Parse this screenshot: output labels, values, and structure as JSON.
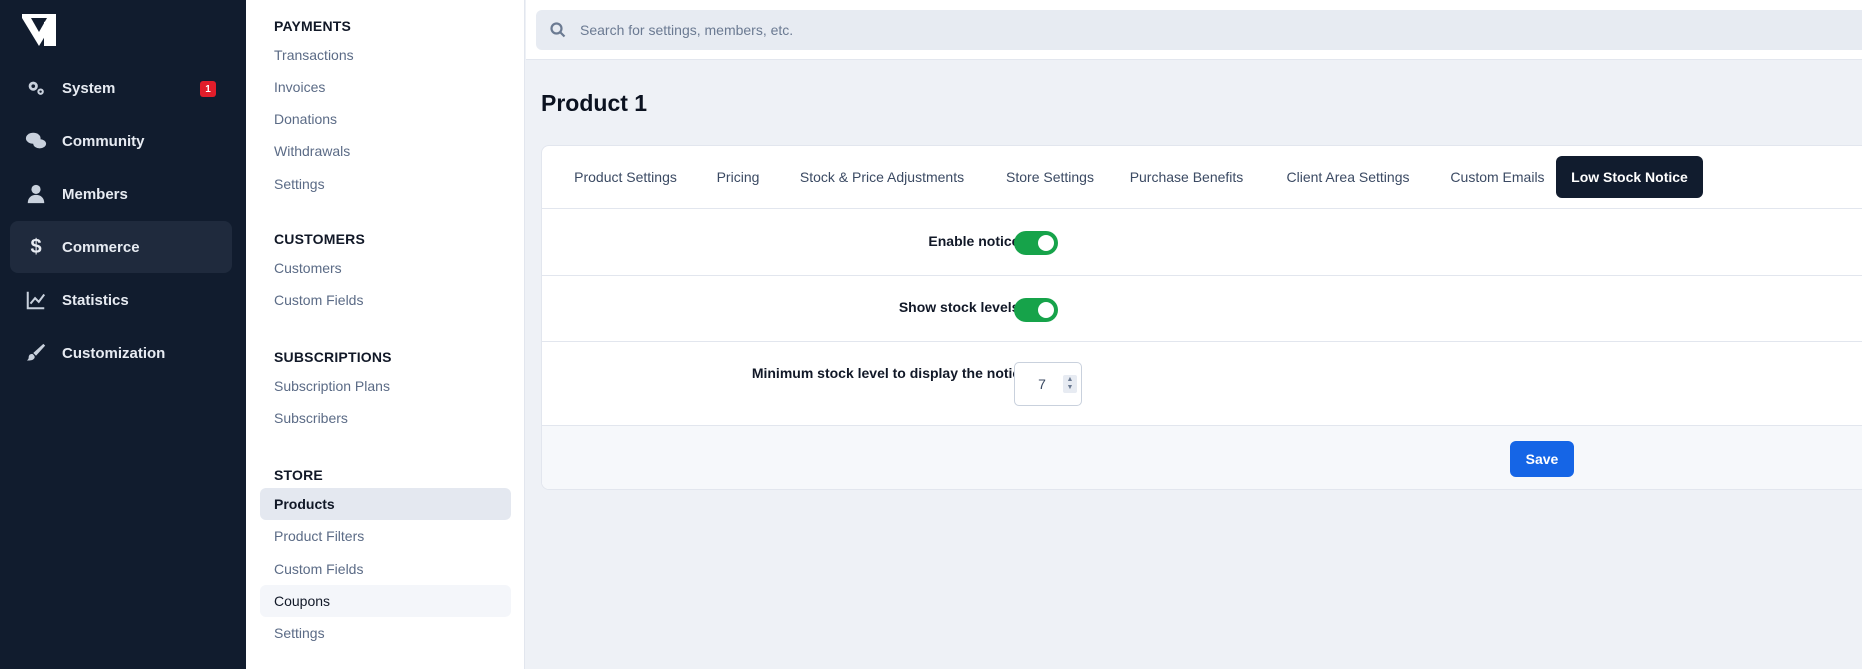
{
  "nav": {
    "logo": "brand-logo",
    "items": [
      {
        "label": "System",
        "icon": "gears-icon",
        "badge": "1"
      },
      {
        "label": "Community",
        "icon": "chat-icon"
      },
      {
        "label": "Members",
        "icon": "user-icon"
      },
      {
        "label": "Commerce",
        "icon": "dollar-icon",
        "active": true
      },
      {
        "label": "Statistics",
        "icon": "chart-line-icon"
      },
      {
        "label": "Customization",
        "icon": "brush-icon"
      }
    ]
  },
  "subnav": {
    "sections": [
      {
        "title": "PAYMENTS",
        "items": [
          "Transactions",
          "Invoices",
          "Donations",
          "Withdrawals",
          "Settings"
        ]
      },
      {
        "title": "CUSTOMERS",
        "items": [
          "Customers",
          "Custom Fields"
        ]
      },
      {
        "title": "SUBSCRIPTIONS",
        "items": [
          "Subscription Plans",
          "Subscribers"
        ]
      },
      {
        "title": "STORE",
        "items": [
          "Products",
          "Product Filters",
          "Custom Fields",
          "Coupons",
          "Settings"
        ]
      }
    ],
    "active_item": "Products"
  },
  "search": {
    "placeholder": "Search for settings, members, etc."
  },
  "page": {
    "title": "Product 1"
  },
  "tabs": [
    "Product Settings",
    "Pricing",
    "Stock & Price Adjustments",
    "Store Settings",
    "Purchase Benefits",
    "Client Area Settings",
    "Custom Emails",
    "Low Stock Notice"
  ],
  "active_tab": "Low Stock Notice",
  "form": {
    "enable_notice": {
      "label": "Enable notice?",
      "on": true
    },
    "show_stock": {
      "label": "Show stock levels?",
      "on": true
    },
    "min_stock": {
      "label": "Minimum stock level to display the notice",
      "value": "7"
    },
    "save_label": "Save"
  },
  "colors": {
    "sidebar": "#111c2e",
    "toggle_on": "#16a34a",
    "primary": "#1565e6",
    "badge": "#e11d2a"
  }
}
